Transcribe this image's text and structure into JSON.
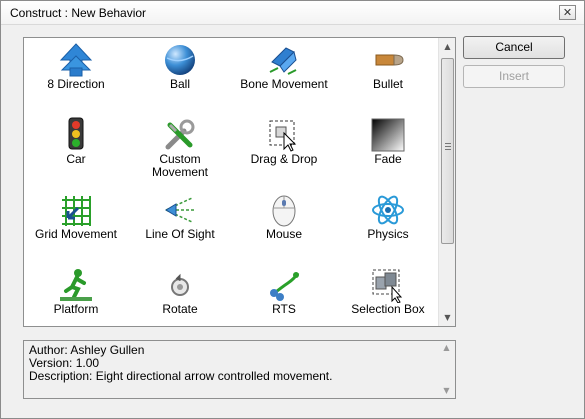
{
  "window": {
    "title": "Construct : New Behavior",
    "close_glyph": "✕"
  },
  "buttons": {
    "cancel_label": "Cancel",
    "insert_label": "Insert"
  },
  "behaviors": [
    {
      "label": "8 Direction",
      "icon": "blue-arrow-up-icon"
    },
    {
      "label": "Ball",
      "icon": "blue-ball-icon"
    },
    {
      "label": "Bone Movement",
      "icon": "bone-movement-icon"
    },
    {
      "label": "Bullet",
      "icon": "bullet-icon"
    },
    {
      "label": "Car",
      "icon": "traffic-light-icon"
    },
    {
      "label": "Custom\nMovement",
      "icon": "tools-icon"
    },
    {
      "label": "Drag & Drop",
      "icon": "drag-drop-icon"
    },
    {
      "label": "Fade",
      "icon": "fade-gradient-icon"
    },
    {
      "label": "Grid Movement",
      "icon": "grid-movement-icon"
    },
    {
      "label": "Line Of Sight",
      "icon": "line-of-sight-icon"
    },
    {
      "label": "Mouse",
      "icon": "mouse-icon"
    },
    {
      "label": "Physics",
      "icon": "atom-icon"
    },
    {
      "label": "Platform",
      "icon": "platform-runner-icon"
    },
    {
      "label": "Rotate",
      "icon": "rotate-icon"
    },
    {
      "label": "RTS",
      "icon": "rts-icon"
    },
    {
      "label": "Selection Box",
      "icon": "selection-box-icon"
    }
  ],
  "description": {
    "author": "Author: Ashley Gullen",
    "version": "Version: 1.00",
    "text": "Description: Eight directional arrow controlled movement."
  },
  "scroll": {
    "up_glyph": "▲",
    "down_glyph": "▼"
  }
}
